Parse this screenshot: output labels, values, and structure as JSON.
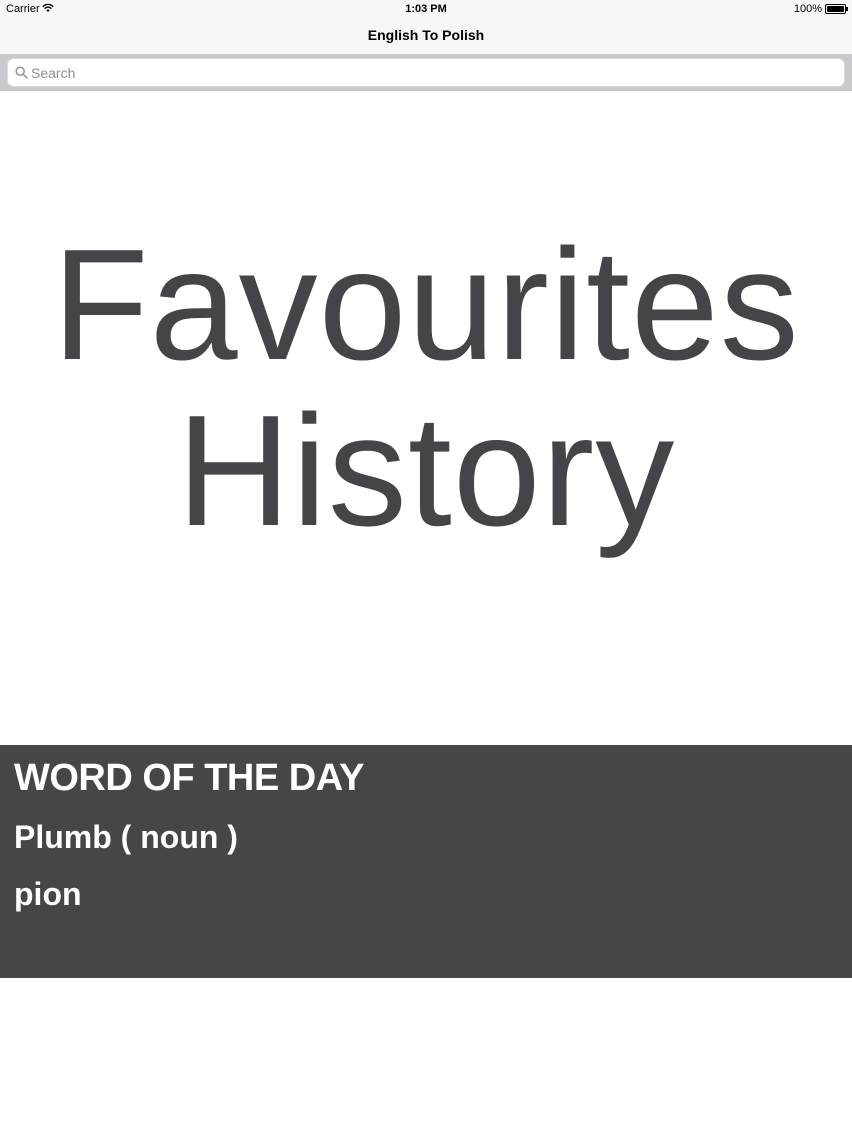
{
  "status_bar": {
    "carrier": "Carrier",
    "time": "1:03 PM",
    "battery": "100%"
  },
  "nav": {
    "title": "English To Polish"
  },
  "search": {
    "placeholder": "Search",
    "value": ""
  },
  "menu": {
    "favourites": "Favourites",
    "history": "History"
  },
  "word_of_the_day": {
    "heading": "WORD OF THE DAY",
    "word": "Plumb ( noun )",
    "translation": "pion"
  },
  "colors": {
    "menu_text": "#464448",
    "wotd_background": "#474548",
    "wotd_text": "#ffffff"
  }
}
